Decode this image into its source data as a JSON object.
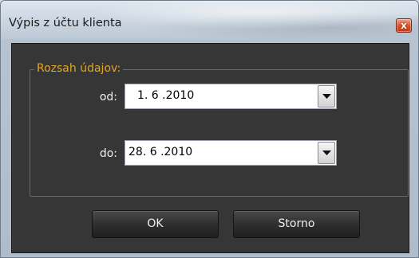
{
  "window": {
    "title": "Výpis z účtu klienta",
    "close_glyph": "x",
    "close_icon": "close-icon"
  },
  "group": {
    "legend": "Rozsah údajov:"
  },
  "fields": {
    "from_label": "od:",
    "from_value": "1. 6 .2010",
    "to_label": "do:",
    "to_value": "28. 6 .2010",
    "dropdown_icon": "chevron-down-icon"
  },
  "buttons": {
    "ok_label": "OK",
    "cancel_label": "Storno"
  },
  "colors": {
    "legend": "#e0a72a",
    "client_background": "#363636",
    "close_button": "#d9542f"
  }
}
